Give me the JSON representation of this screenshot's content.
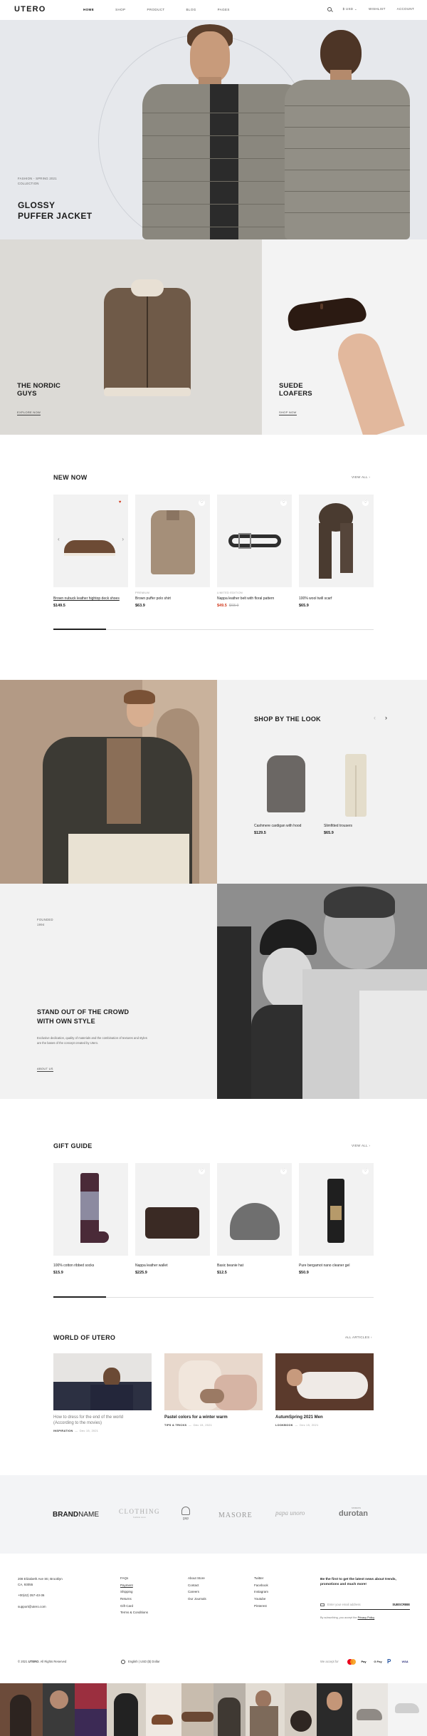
{
  "header": {
    "logo": "UTERO",
    "nav": [
      "HOME",
      "SHOP",
      "PRODUCT",
      "BLOG",
      "PAGES"
    ],
    "currency": "$ USD",
    "wishlist": "WISHLIST",
    "account": "ACCOUNT"
  },
  "hero": {
    "eyebrow_1": "FASHION - SPRING 2021",
    "eyebrow_2": "COLLECTION",
    "title_1": "GLOSSY",
    "title_2": "PUFFER JACKET"
  },
  "promo_tiles": [
    {
      "title_1": "THE NORDIC",
      "title_2": "GUYS",
      "link": "EXPLORE NOW"
    },
    {
      "title_1": "SUEDE",
      "title_2": "LOAFERS",
      "link": "SHOP NOW"
    }
  ],
  "new_now": {
    "title": "NEW NOW",
    "view_all": "VIEW ALL",
    "products": [
      {
        "category": "",
        "name": "Brown nubuck leather hightop deck shoes",
        "price": "$149.5",
        "old_price": "",
        "liked": true
      },
      {
        "category": "PREMIUM",
        "name": "Brown puffer polo shirt",
        "price": "$63.9",
        "old_price": "",
        "liked": false
      },
      {
        "category": "LIMITED EDITION",
        "name": "Nappa leather belt with floral pattern",
        "price": "$49.5",
        "old_price": "$68.9",
        "liked": false
      },
      {
        "category": "",
        "name": "100% wool twill scarf",
        "price": "$65.9",
        "old_price": "",
        "liked": false
      }
    ]
  },
  "shop_the_look": {
    "title": "SHOP BY THE LOOK",
    "items": [
      {
        "name": "Cashmere cardigan with hood",
        "price": "$129.5"
      },
      {
        "name": "Slimfitted trousers",
        "price": "$65.9"
      }
    ]
  },
  "about": {
    "founded": "FOUNDED",
    "year": "1994",
    "title_1": "STAND OUT OF THE CROWD",
    "title_2": "WITH OWN STYLE",
    "text": "Exclusive dedication, quality of materials and the combination of textures and styles are the bases of the concept created by Utero.",
    "link": "ABOUT US"
  },
  "gift_guide": {
    "title": "GIFT GUIDE",
    "view_all": "VIEW ALL",
    "products": [
      {
        "name": "100% cotton ribbed socks",
        "price": "$15.9"
      },
      {
        "name": "Nappa leather wallet",
        "price": "$225.9"
      },
      {
        "name": "Basic beanie hat",
        "price": "$12.5"
      },
      {
        "name": "Pure bergamot nano cleaner gel",
        "price": "$50.9"
      }
    ]
  },
  "world": {
    "title": "WORLD OF UTERO",
    "view_all": "ALL ARTICLES",
    "posts": [
      {
        "title_1": "How to dress for the end of the world",
        "title_2": "(According to the movies)",
        "category": "INSPIRATION",
        "date": "Dec 15, 2021"
      },
      {
        "title_1": "Pastel colors for a winter warm",
        "title_2": "",
        "category": "TIPS & TRICKS",
        "date": "Dec 15, 2021"
      },
      {
        "title_1": "AutumSpring 2021 Men",
        "title_2": "",
        "category": "LOOKBOOK",
        "date": "Dec 15, 2021"
      }
    ]
  },
  "brands": {
    "b1_bold": "BRAND",
    "b1_light": "NAME",
    "b2": "CLOTHING",
    "b2_sub": "fashion store",
    "b3": "gap",
    "b4": "MASORE",
    "b5": "papa unoro",
    "b6": "durotan",
    "b6_sub": "seasons"
  },
  "footer": {
    "address_1": "208 Elizabeth Ave Str, Brooklyn",
    "address_2": "CA, 93055",
    "phone": "+00(42) 357-43-36",
    "email": "support@utero.com",
    "col_help": [
      "FAQs",
      "Payment",
      "Shipping",
      "Returns",
      "Gift Card",
      "Terms & Conditions"
    ],
    "col_store": [
      "About Store",
      "Contact",
      "Careers",
      "Our Journals"
    ],
    "col_social": [
      "Twitter",
      "Facebook",
      "Instagram",
      "Youtube",
      "Pinterest"
    ],
    "newsletter": "Be the first to get the latest news about trends, promotions and much more!",
    "email_placeholder": "Enter your email address",
    "subscribe": "SUBSCRIBE",
    "agree_prefix": "By subscribing, you accept the",
    "agree_link": "Privacy Policy",
    "copyright_prefix": "© 2021",
    "copyright_brand": "UTERO",
    "copyright_suffix": ". All Rights Reserved",
    "locale": "English | USD ($) Dollar",
    "we_accept": "We accept for",
    "payments": [
      "Pay",
      "G Pay",
      "VISA"
    ]
  },
  "colors": {
    "accent_red": "#d23b1f",
    "hero_bg": "#e6e8ec",
    "tile_bg": "#dcdad6",
    "light_grey": "#f2f2f2"
  }
}
